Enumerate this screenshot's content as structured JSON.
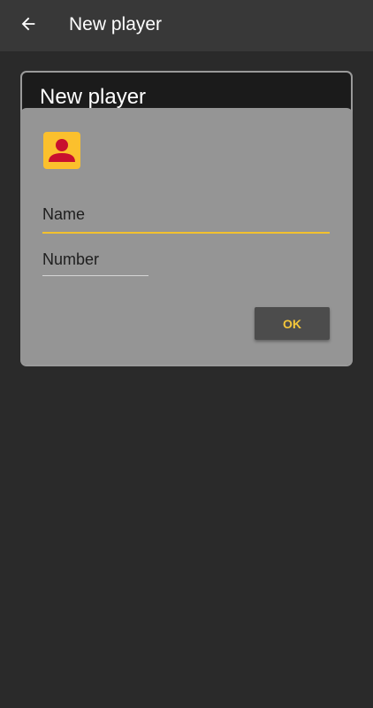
{
  "app_bar": {
    "title": "New player",
    "back_icon": "arrow-left-icon"
  },
  "dialog": {
    "title": "New player",
    "avatar_icon": "person-icon",
    "fields": {
      "name_label": "Name",
      "number_label": "Number"
    },
    "ok_label": "OK"
  },
  "colors": {
    "app_bar_bg": "#383838",
    "page_bg": "#2a2a2a",
    "dialog_body_bg": "#959595",
    "accent_yellow": "#fbc02d",
    "avatar_person": "#c8102e",
    "ok_button_bg": "#4c4c4c",
    "ok_text": "#f4c63a"
  }
}
